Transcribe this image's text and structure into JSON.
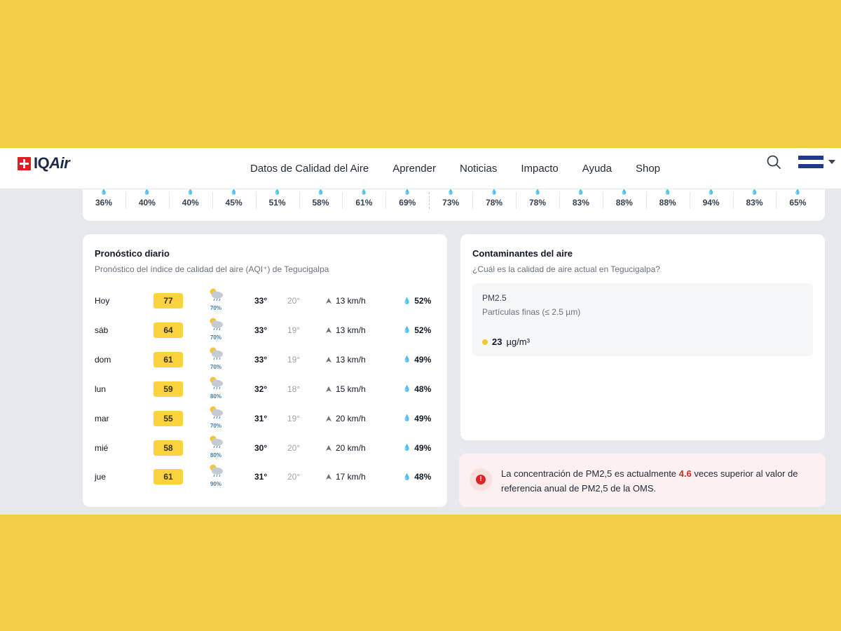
{
  "nav": {
    "logo": "IQAir",
    "items": [
      "Datos de Calidad del Aire",
      "Aprender",
      "Noticias",
      "Impacto",
      "Ayuda",
      "Shop"
    ],
    "flag_colors": [
      "#1e3a8a",
      "#ffffff",
      "#1e3a8a"
    ]
  },
  "hourly": {
    "humidity": [
      "36%",
      "40%",
      "40%",
      "45%",
      "51%",
      "58%",
      "61%",
      "69%",
      "73%",
      "78%",
      "78%",
      "83%",
      "88%",
      "88%",
      "94%",
      "83%",
      "65%"
    ]
  },
  "forecast": {
    "title": "Pronóstico diario",
    "subtitle": "Pronóstico del índice de calidad del aire (AQI⁺) de Tegucigalpa",
    "rows": [
      {
        "day": "Hoy",
        "aqi": "77",
        "rain": "70%",
        "max": "33°",
        "min": "20°",
        "wind": "13 km/h",
        "humidity": "52%"
      },
      {
        "day": "sáb",
        "aqi": "64",
        "rain": "70%",
        "max": "33°",
        "min": "19°",
        "wind": "13 km/h",
        "humidity": "52%"
      },
      {
        "day": "dom",
        "aqi": "61",
        "rain": "70%",
        "max": "33°",
        "min": "19°",
        "wind": "13 km/h",
        "humidity": "49%"
      },
      {
        "day": "lun",
        "aqi": "59",
        "rain": "80%",
        "max": "32°",
        "min": "18°",
        "wind": "15 km/h",
        "humidity": "48%"
      },
      {
        "day": "mar",
        "aqi": "55",
        "rain": "70%",
        "max": "31°",
        "min": "19°",
        "wind": "20 km/h",
        "humidity": "49%"
      },
      {
        "day": "mié",
        "aqi": "58",
        "rain": "80%",
        "max": "30°",
        "min": "20°",
        "wind": "20 km/h",
        "humidity": "49%"
      },
      {
        "day": "jue",
        "aqi": "61",
        "rain": "90%",
        "max": "31°",
        "min": "20°",
        "wind": "17 km/h",
        "humidity": "48%"
      }
    ],
    "aqi_color": "#fad33e"
  },
  "pollutants": {
    "title": "Contaminantes del aire",
    "subtitle": "¿Cuál es la calidad de aire actual en Tegucigalpa?",
    "pm_name": "PM2.5",
    "pm_desc": "Partículas finas (≤ 2.5 µm)",
    "pm_value": "23",
    "pm_unit": "µg/m³"
  },
  "alert": {
    "text_before": "La concentración de PM2,5 es actualmente ",
    "highlight": "4.6",
    "text_after": " veces superior al valor de referencia anual de PM2,5 de la OMS.",
    "color": "#e02424"
  }
}
